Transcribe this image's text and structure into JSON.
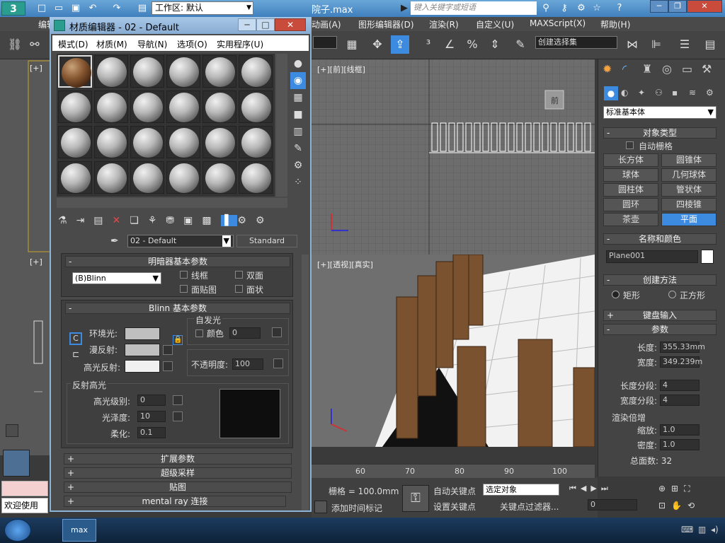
{
  "app": {
    "workspace_label": "工作区: 默认",
    "filename": "院子.max",
    "search_placeholder": "键入关键字或短语"
  },
  "menubar": {
    "items": [
      "编辑(E)",
      "动画(A)",
      "图形编辑器(D)",
      "渲染(R)",
      "自定义(U)",
      "MAXScript(X)",
      "帮助(H)"
    ]
  },
  "toolbar": {
    "selection_set": "创建选择集"
  },
  "viewports": {
    "left_label": "[+]",
    "left2_label": "[+]",
    "front_label": "[+][前][线框]",
    "persp_label": "[+][透视][真实]",
    "viewcube_front": "前",
    "ruler": [
      "60",
      "70",
      "80",
      "90",
      "100"
    ]
  },
  "material_editor": {
    "title": "材质编辑器 - 02 - Default",
    "menu": [
      "模式(D)",
      "材质(M)",
      "导航(N)",
      "选项(O)",
      "实用程序(U)"
    ],
    "material_name": "02 - Default",
    "material_type": "Standard",
    "shader_params": {
      "header": "明暗器基本参数",
      "shader": "(B)Blinn",
      "wire": "线框",
      "two_sided": "双面",
      "face_map": "面贴图",
      "faceted": "面状"
    },
    "blinn_params": {
      "header": "Blinn 基本参数",
      "self_illum": "自发光",
      "color_label": "颜色",
      "color_value": "0",
      "ambient": "环境光:",
      "diffuse": "漫反射:",
      "specular": "高光反射:",
      "opacity_label": "不透明度:",
      "opacity_value": "100"
    },
    "spec_highlights": {
      "header": "反射高光",
      "level_label": "高光级别:",
      "level_value": "0",
      "gloss_label": "光泽度:",
      "gloss_value": "10",
      "soften_label": "柔化:",
      "soften_value": "0.1"
    },
    "rollouts": [
      "扩展参数",
      "超级采样",
      "贴图",
      "mental ray 连接"
    ]
  },
  "command_panel": {
    "category": "标准基本体",
    "object_type_header": "对象类型",
    "autogrid": "自动栅格",
    "buttons": [
      "长方体",
      "圆锥体",
      "球体",
      "几何球体",
      "圆柱体",
      "管状体",
      "圆环",
      "四棱锥",
      "茶壶",
      "平面"
    ],
    "active_button": "平面",
    "name_color_header": "名称和颜色",
    "object_name": "Plane001",
    "creation_method_header": "创建方法",
    "radio_rect": "矩形",
    "radio_square": "正方形",
    "keyboard_entry_header": "键盘输入",
    "params_header": "参数",
    "length_label": "长度:",
    "length_value": "355.33mm",
    "width_label": "宽度:",
    "width_value": "349.239m",
    "length_segs_label": "长度分段:",
    "length_segs_value": "4",
    "width_segs_label": "宽度分段:",
    "width_segs_value": "4",
    "render_mult_label": "渲染倍增",
    "scale_label": "缩放:",
    "scale_value": "1.0",
    "density_label": "密度:",
    "density_value": "1.0",
    "total_faces": "总面数: 32"
  },
  "status": {
    "grid": "栅格 = 100.0mm",
    "auto_key": "自动关键点",
    "set_key": "设置关键点",
    "selected": "选定对象",
    "add_time_tag": "添加时间标记",
    "key_filters": "关键点过滤器...",
    "frame_value": "0",
    "welcome": "欢迎使用"
  },
  "colors": {
    "accent": "#3d8be0",
    "title_gradient_top": "#6aa7d8"
  }
}
